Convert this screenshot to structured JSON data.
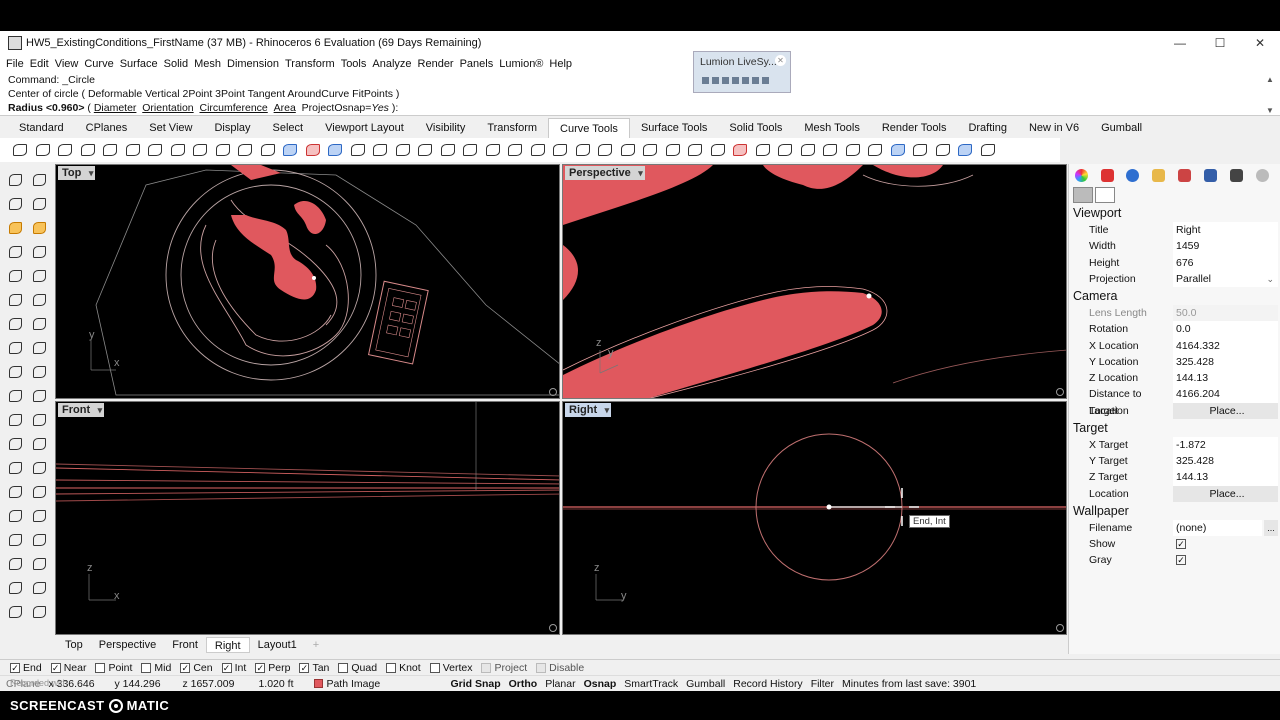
{
  "window": {
    "title": "HW5_ExistingConditions_FirstName (37 MB) - Rhinoceros 6 Evaluation (69 Days Remaining)",
    "controls": [
      "—",
      "☐",
      "✕"
    ]
  },
  "menu": [
    "File",
    "Edit",
    "View",
    "Curve",
    "Surface",
    "Solid",
    "Mesh",
    "Dimension",
    "Transform",
    "Tools",
    "Analyze",
    "Render",
    "Panels",
    "Lumion®",
    "Help"
  ],
  "command": {
    "line1": "Command: _Circle",
    "line2": "Center of circle ( Deformable  Vertical  2Point  3Point  Tangent  AroundCurve  FitPoints )",
    "prompt_bold": "Radius <0.960>",
    "prompt_open": " ( ",
    "options": [
      "Diameter",
      "Orientation",
      "Circumference",
      "Area"
    ],
    "projectosnap_label": "ProjectOsnap=",
    "projectosnap_value": "Yes",
    "prompt_close": " ):"
  },
  "lumion": {
    "title": "Lumion LiveSy..."
  },
  "tabs": [
    "Standard",
    "CPlanes",
    "Set View",
    "Display",
    "Select",
    "Viewport Layout",
    "Visibility",
    "Transform",
    "Curve Tools",
    "Surface Tools",
    "Solid Tools",
    "Mesh Tools",
    "Render Tools",
    "Drafting",
    "New in V6",
    "Gumball"
  ],
  "active_tab": "Curve Tools",
  "viewports": {
    "top": {
      "label": "Top",
      "axis_y": "y",
      "axis_x": "x"
    },
    "perspective": {
      "label": "Perspective",
      "axis_z": "z",
      "axis_y": "y"
    },
    "front": {
      "label": "Front",
      "axis_z": "z",
      "axis_x": "x"
    },
    "right": {
      "label": "Right",
      "axis_z": "z",
      "axis_y": "y",
      "tooltip": "End, Int"
    }
  },
  "viewport_tabs": [
    "Top",
    "Perspective",
    "Front",
    "Right",
    "Layout1",
    "+"
  ],
  "active_viewport_tab": "Right",
  "panel": {
    "sections": {
      "viewport": "Viewport",
      "camera": "Camera",
      "target": "Target",
      "wallpaper": "Wallpaper"
    },
    "viewport_rows": [
      {
        "k": "Title",
        "v": "Right"
      },
      {
        "k": "Width",
        "v": "1459"
      },
      {
        "k": "Height",
        "v": "676"
      },
      {
        "k": "Projection",
        "v": "Parallel"
      }
    ],
    "camera_rows": [
      {
        "k": "Lens Length",
        "v": "50.0"
      },
      {
        "k": "Rotation",
        "v": "0.0"
      },
      {
        "k": "X Location",
        "v": "4164.332"
      },
      {
        "k": "Y Location",
        "v": "325.428"
      },
      {
        "k": "Z Location",
        "v": "144.13"
      },
      {
        "k": "Distance to Target",
        "v": "4166.204"
      },
      {
        "k": "Location",
        "v": "Place..."
      }
    ],
    "target_rows": [
      {
        "k": "X Target",
        "v": "-1.872"
      },
      {
        "k": "Y Target",
        "v": "325.428"
      },
      {
        "k": "Z Target",
        "v": "144.13"
      },
      {
        "k": "Location",
        "v": "Place..."
      }
    ],
    "wallpaper_rows": [
      {
        "k": "Filename",
        "v": "(none)",
        "btn": "..."
      },
      {
        "k": "Show",
        "v": "✓"
      },
      {
        "k": "Gray",
        "v": "✓"
      }
    ]
  },
  "osnaps": [
    {
      "label": "End",
      "checked": true
    },
    {
      "label": "Near",
      "checked": true
    },
    {
      "label": "Point",
      "checked": false
    },
    {
      "label": "Mid",
      "checked": false
    },
    {
      "label": "Cen",
      "checked": true
    },
    {
      "label": "Int",
      "checked": true
    },
    {
      "label": "Perp",
      "checked": true
    },
    {
      "label": "Tan",
      "checked": true
    },
    {
      "label": "Quad",
      "checked": false
    },
    {
      "label": "Knot",
      "checked": false
    },
    {
      "label": "Vertex",
      "checked": false
    },
    {
      "label": "Project",
      "checked": false,
      "disabled": true
    },
    {
      "label": "Disable",
      "checked": false,
      "disabled": true
    }
  ],
  "status": {
    "cplane": "CPlane",
    "x": "x 336.646",
    "y": "y 144.296",
    "z": "z 1657.009",
    "unit": "1.020 ft",
    "layer": "Path Image",
    "toggles": [
      "Grid Snap",
      "Ortho",
      "Planar",
      "Osnap",
      "SmartTrack",
      "Gumball",
      "Record History",
      "Filter"
    ],
    "bold_toggles": [
      "Grid Snap",
      "Ortho",
      "Osnap"
    ],
    "save_note": "Minutes from last save: 3901"
  },
  "watermark": {
    "left": "SCREENCAST",
    "right": "MATIC",
    "ghost": "Recorded with"
  },
  "colors": {
    "curve_red": "#e0585e",
    "viewport_bg": "#000000",
    "panel_bg": "#f7f7f7",
    "active_label": "#c8d6ea"
  }
}
